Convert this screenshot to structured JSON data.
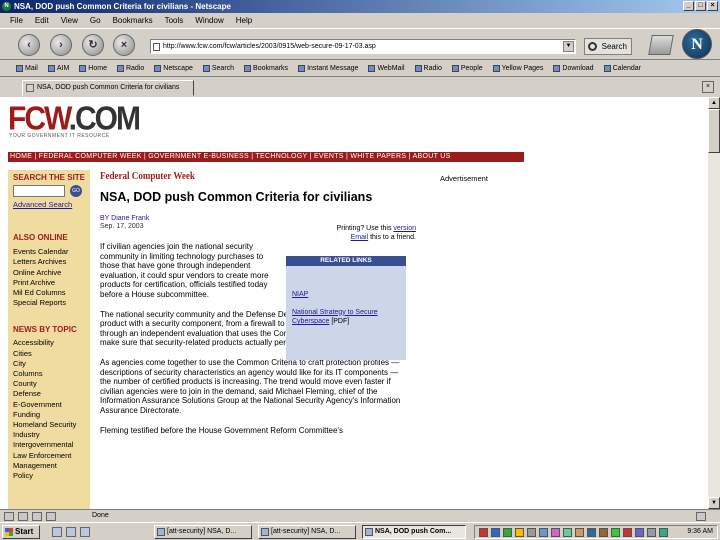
{
  "window": {
    "title": "NSA, DOD push Common Criteria for civilians - Netscape"
  },
  "menu": [
    "File",
    "Edit",
    "View",
    "Go",
    "Bookmarks",
    "Tools",
    "Window",
    "Help"
  ],
  "nav": {
    "url": "http://www.fcw.com/fcw/articles/2003/0915/web-secure-09-17-03.asp",
    "search_label": "Search"
  },
  "bookmarks": [
    "Mail",
    "AIM",
    "Home",
    "Radio",
    "Netscape",
    "Search",
    "Bookmarks",
    "Instant Message",
    "WebMail",
    "Radio",
    "People",
    "Yellow Pages",
    "Download",
    "Calendar"
  ],
  "tab": {
    "label": "NSA, DOD push Common Criteria for civilians"
  },
  "site": {
    "logo_fcw": "FCW",
    "logo_com": ".COM",
    "tagline": "YOUR GOVERNMENT IT RESOURCE",
    "nav_bar": "HOME | FEDERAL COMPUTER WEEK | GOVERNMENT E-BUSINESS | TECHNOLOGY | EVENTS | WHITE PAPERS | ABOUT US"
  },
  "sidebar": {
    "search_heading": "SEARCH THE SITE",
    "go": "GO",
    "advanced_search": "Advanced Search",
    "also_online_heading": "ALSO ONLINE",
    "also_online": [
      "Events Calendar",
      "Letters Archives",
      "Online Archive",
      "Print Archive",
      "Mil Ed Columns",
      "Special Reports"
    ],
    "news_heading": "NEWS BY TOPIC",
    "news": [
      "Accessibility",
      "Cities",
      "City",
      "Columns",
      "County",
      "Defense",
      "E-Government",
      "Funding",
      "Homeland Security",
      "Industry",
      "Intergovernmental",
      "Law Enforcement",
      "Management",
      "Policy"
    ]
  },
  "article": {
    "publication": "Federal Computer Week",
    "headline": "NSA, DOD push Common Criteria for civilians",
    "byline": "BY Diane Frank",
    "date": "Sep. 17, 2003",
    "printing_line1": "Printing? Use this",
    "printing_link1": "version",
    "printing_link2": "Email",
    "printing_line2": "this to a friend.",
    "related_heading": "RELATED LINKS",
    "related_links": [
      "NIAP",
      "National Strategy to Secure",
      "Cyberspace"
    ],
    "related_pdf": "[PDF]",
    "paragraphs": [
      "If civilian agencies join the national security community in limiting technology purchases to those that have gone through independent evaluation, it could spur vendors to create more products for certification, officials testified today before a House subcommittee.",
      "The national security community and the Defense Department already require any product with a security component, from a firewall to an operating system, to go through an independent evaluation that uses the Common Criteria, a set of tools to make sure that security-related products actually perform the way a vendor states.",
      "As agencies come together to use the Common Criteria to craft protection profiles — descriptions of security characteristics an agency would like for its IT components — the number of certified products is increasing. The trend would move even faster if civilian agencies were to join in the demand, said Michael Fleming, chief of the Information Assurance Solutions Group at the National Security Agency's Information Assurance Directorate.",
      "Fleming testified before the House Government Reform Committee's"
    ],
    "advertisement": "Advertisement"
  },
  "status": {
    "text": "Done"
  },
  "taskbar": {
    "start": "Start",
    "tasks": [
      "[att-security] NSA, D...",
      "[att-security] NSA, D...",
      "NSA, DOD push Com..."
    ],
    "clock": "9:36 AM"
  }
}
